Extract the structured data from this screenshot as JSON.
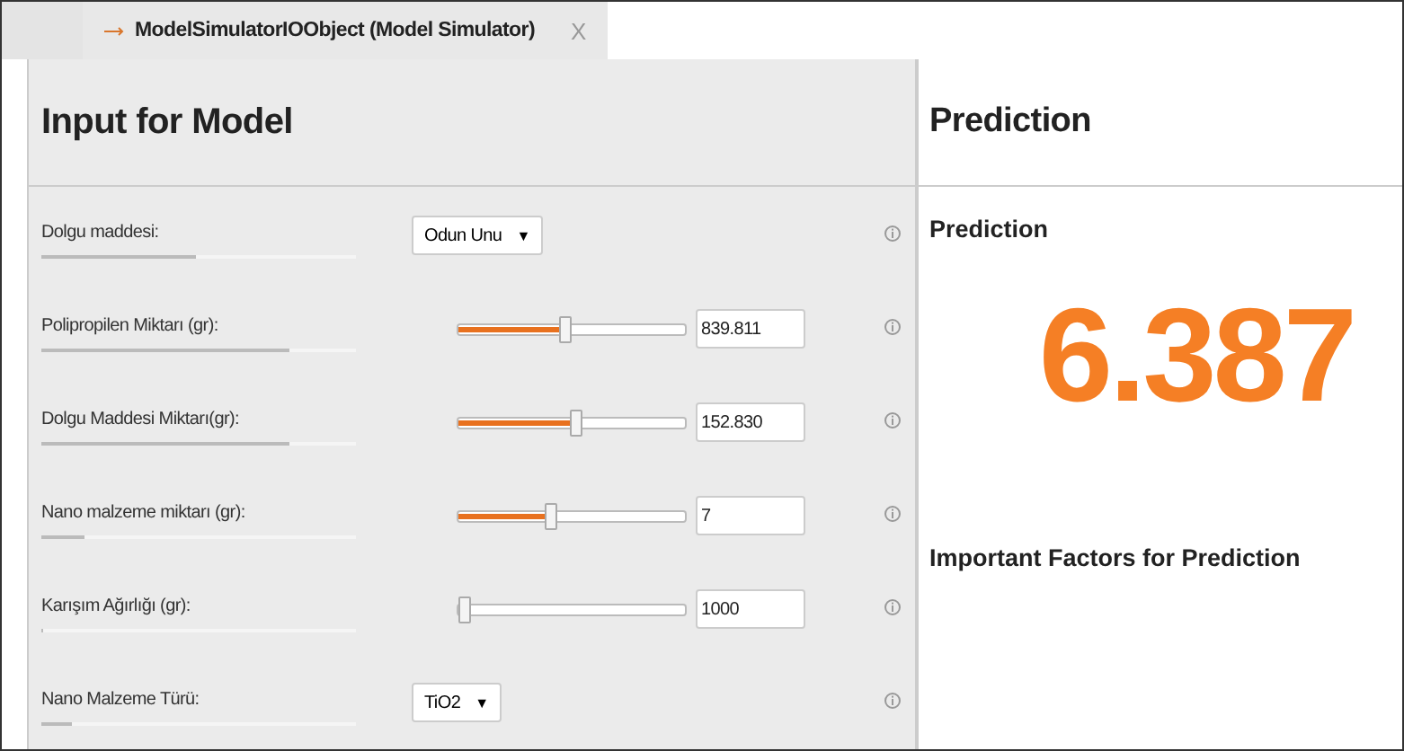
{
  "tab": {
    "title": "ModelSimulatorIOObject (Model Simulator)",
    "close": "X"
  },
  "input_panel": {
    "title": "Input for Model",
    "rows": [
      {
        "kind": "dropdown",
        "label": "Dolgu maddesi:",
        "importance": {
          "level": 0.49
        },
        "value": "Odun Unu",
        "caret": "▼"
      },
      {
        "kind": "slider",
        "label": "Polipropilen Miktarı (gr):",
        "importance": {
          "level": 0.79
        },
        "level": 0.47,
        "value": "839.811"
      },
      {
        "kind": "slider",
        "label": "Dolgu Maddesi Miktarı(gr):",
        "importance": {
          "level": 0.79
        },
        "level": 0.52,
        "value": "152.830"
      },
      {
        "kind": "slider",
        "label": "Nano malzeme miktarı (gr):",
        "importance": {
          "level": 0.13
        },
        "level": 0.4,
        "value": "7"
      },
      {
        "kind": "slider",
        "label": "Karışım Ağırlığı (gr):",
        "importance": {
          "level": 0
        },
        "level": 0,
        "value": "1000"
      },
      {
        "kind": "dropdown",
        "label": "Nano Malzeme Türü:",
        "importance": {
          "level": 0.09
        },
        "value": "TiO2",
        "caret": "▼"
      }
    ]
  },
  "prediction_panel": {
    "title": "Prediction",
    "subtitle": "Prediction",
    "value": "6.387",
    "factors_title": "Important Factors for Prediction"
  }
}
